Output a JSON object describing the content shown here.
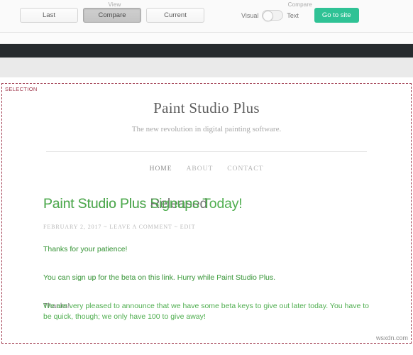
{
  "toolbar": {
    "view_caption": "View",
    "compare_caption": "Compare",
    "buttons": [
      {
        "label": "Last",
        "active": false
      },
      {
        "label": "Compare",
        "active": true
      },
      {
        "label": "Current",
        "active": false
      }
    ],
    "toggle": {
      "left_label": "Visual",
      "right_label": "Text",
      "state": "Visual"
    },
    "go_to_site_label": "Go to site"
  },
  "selection": {
    "label": "SELECTION"
  },
  "site": {
    "title": "Paint Studio Plus",
    "tagline": "The new revolution in digital painting software.",
    "nav": [
      {
        "label": "HOME",
        "active": true
      },
      {
        "label": "ABOUT",
        "active": false
      },
      {
        "label": "CONTACT",
        "active": false
      }
    ]
  },
  "post": {
    "title_old": "Paint Studio Plus Released",
    "title_new": "Paint Studio Plus Signups Today!",
    "meta": "FEBRUARY 2, 2017 ~ LEAVE A COMMENT ~ EDIT",
    "p1_old": "Thanks for your patience!",
    "p1_new": "Thanks for your patience!",
    "p2_old": "You can sign up for the beta on this link. Hurry while Paint Studio Plus.",
    "p2_new": "You can sign up for the beta on this link. Hurry while Paint Studio Plus.",
    "p3_old": "Thanks!",
    "p3_new": "We are very pleased to announce that we have some beta keys to give out later today. You have to be quick, though; we only have 100 to give away!"
  },
  "watermark": "wsxdn.com",
  "colors": {
    "accent_green": "#2fc295",
    "diff_new": "#4fae4f",
    "diff_old": "#6f6f6f",
    "selection_border": "#a03a4e",
    "dark_band": "#272b2e"
  }
}
